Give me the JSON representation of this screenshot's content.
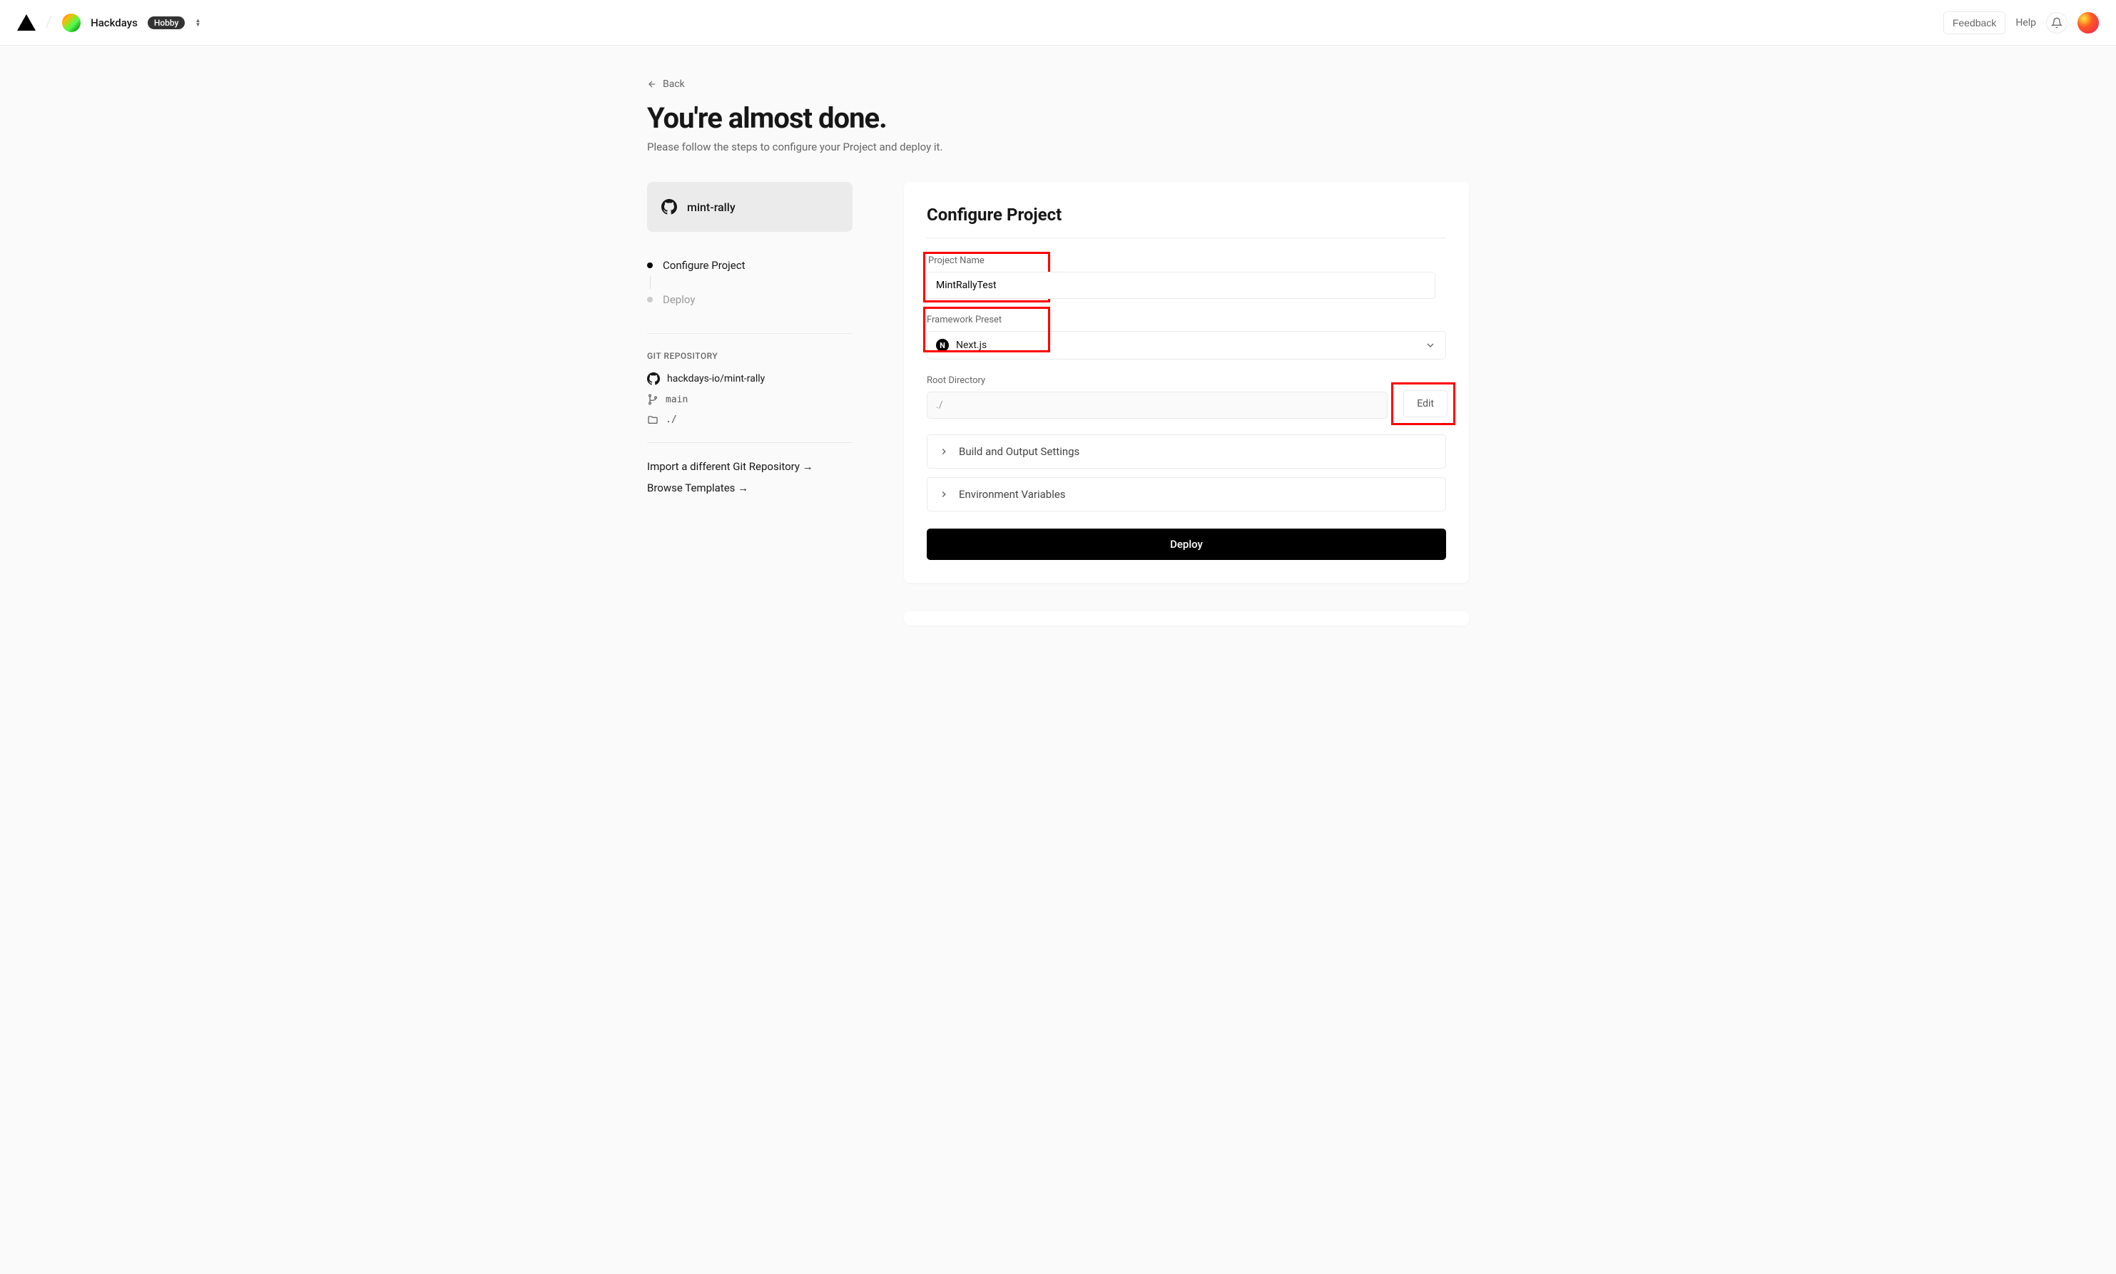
{
  "header": {
    "team_name": "Hackdays",
    "plan_badge": "Hobby",
    "feedback": "Feedback",
    "help": "Help"
  },
  "back_label": "Back",
  "title": "You're almost done.",
  "subtitle": "Please follow the steps to configure your Project and deploy it.",
  "sidebar": {
    "repo_name": "mint-rally",
    "steps": [
      {
        "label": "Configure Project",
        "active": true
      },
      {
        "label": "Deploy",
        "active": false
      }
    ],
    "git_section_label": "GIT REPOSITORY",
    "git_repo": "hackdays-io/mint-rally",
    "git_branch": "main",
    "git_path": "./",
    "link_import": "Import a different Git Repository →",
    "link_browse": "Browse Templates →"
  },
  "card": {
    "title": "Configure Project",
    "project_name_label": "Project Name",
    "project_name_value": "MintRallyTest",
    "framework_label": "Framework Preset",
    "framework_value": "Next.js",
    "root_dir_label": "Root Directory",
    "root_dir_value": "./",
    "edit_label": "Edit",
    "build_settings_label": "Build and Output Settings",
    "env_vars_label": "Environment Variables",
    "deploy_label": "Deploy"
  }
}
